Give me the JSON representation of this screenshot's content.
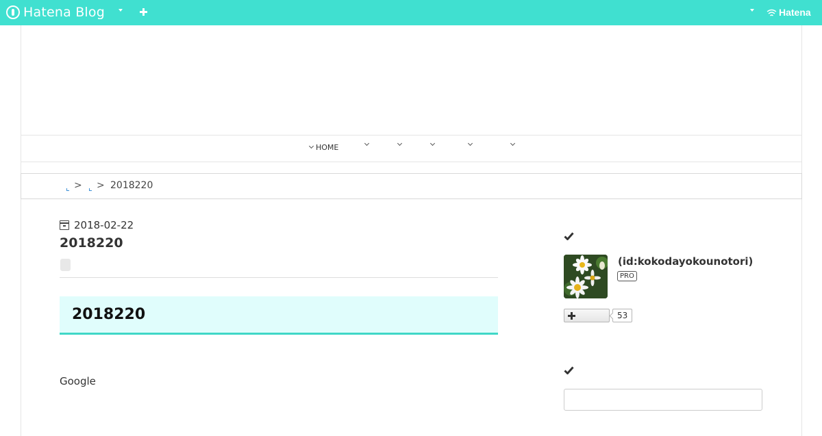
{
  "topbar": {
    "brand": "Hatena Blog",
    "hatena_label": "Hatena",
    "bg_color": "#40e0d0"
  },
  "nav": {
    "items": [
      {
        "label": "HOME"
      },
      {
        "label": ""
      },
      {
        "label": ""
      },
      {
        "label": ""
      },
      {
        "label": ""
      },
      {
        "label": ""
      }
    ]
  },
  "breadcrumb": {
    "separator": ">",
    "current": "2018220"
  },
  "entry": {
    "date": "2018-02-22",
    "title": "2018220",
    "section_heading": "2018220",
    "body_text": "Google",
    "heading_bg": "#e0fdfc",
    "heading_border": "#40d7c7"
  },
  "sidebar": {
    "profile_id": "(id:kokodayokounotori)",
    "pro_badge": "PRO",
    "follower_count": "53",
    "check_icon": "check-icon"
  }
}
